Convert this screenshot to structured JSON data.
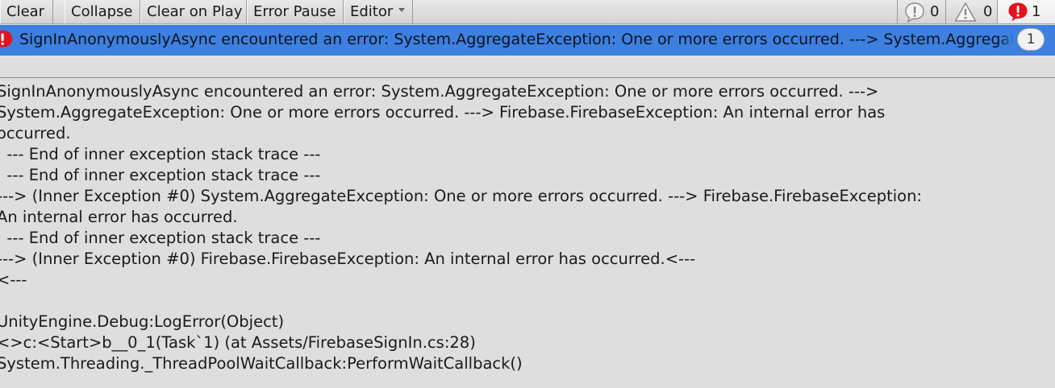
{
  "toolbar": {
    "clear_label": "Clear",
    "collapse_label": "Collapse",
    "clear_on_play_label": "Clear on Play",
    "error_pause_label": "Error Pause",
    "editor_label": "Editor",
    "log_count": "0",
    "warning_count": "0",
    "error_count": "1",
    "log_icon": "info-icon",
    "warning_icon": "warning-icon",
    "error_icon": "error-icon"
  },
  "selected_entry": {
    "text": "SignInAnonymouslyAsync encountered an error: System.AggregateException: One or more errors occurred. ---> System.AggregateException",
    "count": "1",
    "icon": "error-icon"
  },
  "detail": {
    "lines": [
      "SignInAnonymouslyAsync encountered an error: System.AggregateException: One or more errors occurred. --->",
      "System.AggregateException: One or more errors occurred. ---> Firebase.FirebaseException: An internal error has",
      "occurred.",
      "  --- End of inner exception stack trace ---",
      "  --- End of inner exception stack trace ---",
      "---> (Inner Exception #0) System.AggregateException: One or more errors occurred. ---> Firebase.FirebaseException:",
      "An internal error has occurred.",
      "  --- End of inner exception stack trace ---",
      "---> (Inner Exception #0) Firebase.FirebaseException: An internal error has occurred.<---",
      "<---",
      "",
      "UnityEngine.Debug:LogError(Object)",
      "<>c:<Start>b__0_1(Task`1) (at Assets/FirebaseSignIn.cs:28)",
      "System.Threading._ThreadPoolWaitCallback:PerformWaitCallback()"
    ]
  },
  "colors": {
    "toolbar_bg": "#dcdcdc",
    "selection": "#3d80df",
    "panel_bg": "#dedede",
    "error_red": "#e0141e"
  }
}
